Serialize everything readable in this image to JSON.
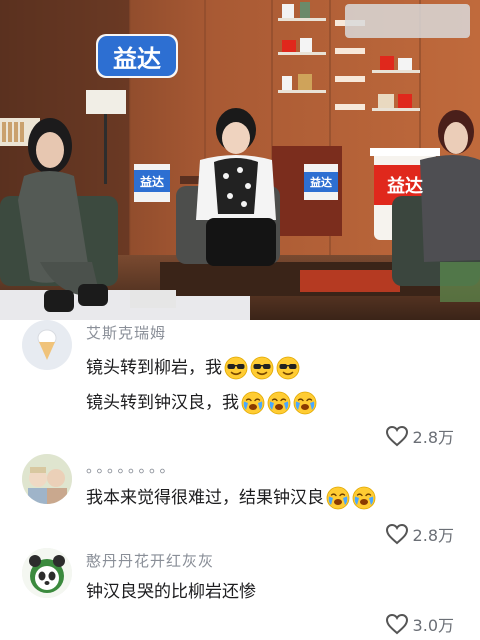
{
  "video": {
    "logo_text": "益达",
    "logo_small_text": "益达",
    "cup_label": "益达",
    "cup_label_2": "益达"
  },
  "comments": [
    {
      "username": "艾斯克瑞姆",
      "lines": [
        {
          "text": "镜头转到柳岩，我",
          "emojis": [
            "sunglasses-face",
            "sunglasses-face",
            "sunglasses-face"
          ]
        },
        {
          "text": "镜头转到钟汉良，我",
          "emojis": [
            "crying-face",
            "crying-face",
            "crying-face"
          ]
        }
      ],
      "likes": "2.8万",
      "avatar": "ice-cream-avatar"
    },
    {
      "username": "。。。。。。。。",
      "lines": [
        {
          "text": "我本来觉得很难过，结果钟汉良",
          "emojis": [
            "crying-face",
            "crying-face"
          ]
        }
      ],
      "likes": "2.8万",
      "avatar": "photo-avatar"
    },
    {
      "username": "憨丹丹花开红灰灰",
      "lines": [
        {
          "text": "钟汉良哭的比柳岩还惨",
          "emojis": []
        }
      ],
      "likes": "3.0万",
      "avatar": "panda-avatar"
    }
  ],
  "colors": {
    "brand_blue": "#2d6fd2",
    "brand_red": "#e0281c",
    "wall": "#b5623a",
    "username_gray": "#8a8f98"
  }
}
